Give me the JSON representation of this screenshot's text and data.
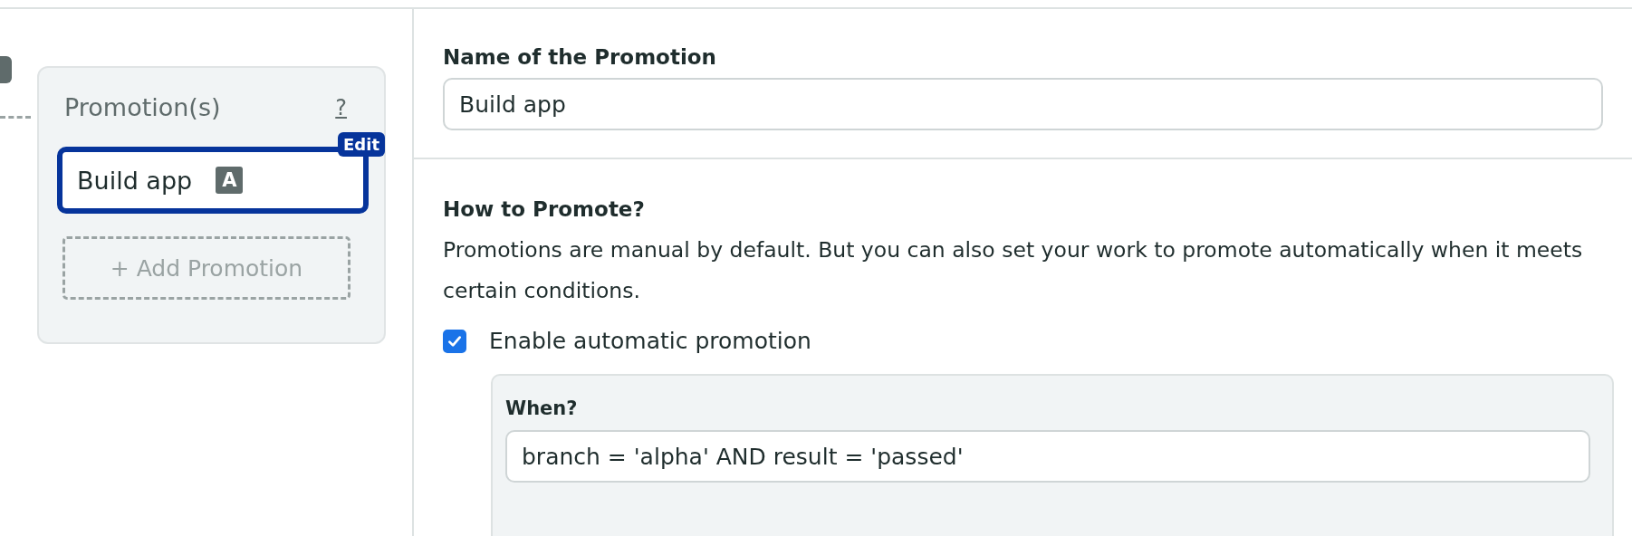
{
  "promotions_panel": {
    "title": "Promotion(s)",
    "help": "?",
    "promotions": [
      {
        "name": "Build app",
        "badge": "A",
        "selected": true,
        "edit_label": "Edit"
      }
    ],
    "add_button": "+ Add Promotion"
  },
  "form": {
    "name_label": "Name of the Promotion",
    "name_value": "Build app",
    "how_title": "How to Promote?",
    "how_text": "Promotions are manual by default. But you can also set your work to promote automatically when it meets certain conditions.",
    "auto_promotion": {
      "label": "Enable automatic promotion",
      "checked": true
    },
    "when": {
      "label": "When?",
      "value": "branch = 'alpha' AND result = 'passed'"
    }
  }
}
